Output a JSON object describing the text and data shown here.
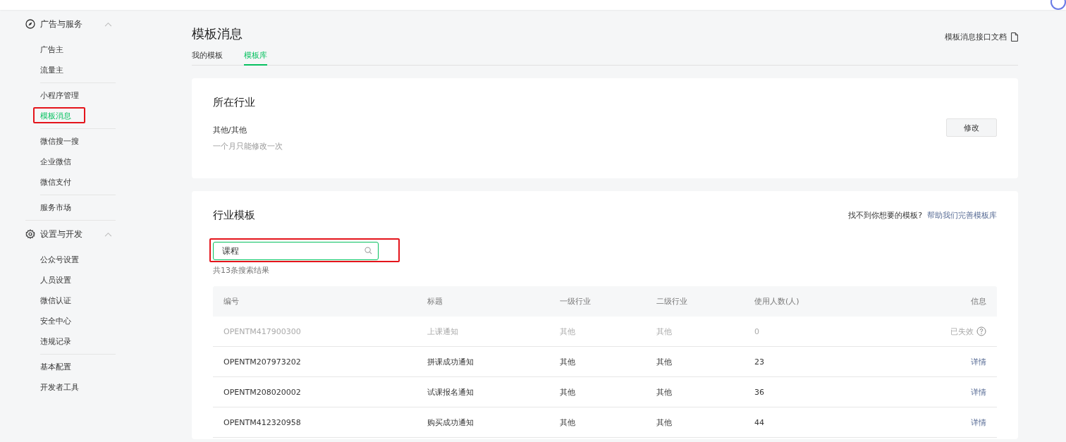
{
  "sidebar": {
    "groups": [
      {
        "title": "广告与服务",
        "kind": "compass",
        "expanded": true,
        "sections": [
          [
            {
              "label": "广告主",
              "selected": false,
              "annotated": false
            },
            {
              "label": "流量主",
              "selected": false,
              "annotated": false
            }
          ],
          [
            {
              "label": "小程序管理",
              "selected": false,
              "annotated": false
            },
            {
              "label": "模板消息",
              "selected": true,
              "annotated": true
            }
          ],
          [
            {
              "label": "微信搜一搜",
              "selected": false,
              "annotated": false
            },
            {
              "label": "企业微信",
              "selected": false,
              "annotated": false
            },
            {
              "label": "微信支付",
              "selected": false,
              "annotated": false
            }
          ],
          [
            {
              "label": "服务市场",
              "selected": false,
              "annotated": false
            }
          ]
        ]
      },
      {
        "title": "设置与开发",
        "kind": "gear",
        "expanded": true,
        "sections": [
          [
            {
              "label": "公众号设置",
              "selected": false,
              "annotated": false
            },
            {
              "label": "人员设置",
              "selected": false,
              "annotated": false
            },
            {
              "label": "微信认证",
              "selected": false,
              "annotated": false
            },
            {
              "label": "安全中心",
              "selected": false,
              "annotated": false
            },
            {
              "label": "违规记录",
              "selected": false,
              "annotated": false
            }
          ],
          [
            {
              "label": "基本配置",
              "selected": false,
              "annotated": false
            },
            {
              "label": "开发者工具",
              "selected": false,
              "annotated": false
            }
          ]
        ]
      }
    ]
  },
  "page": {
    "title": "模板消息",
    "doc_link": "模板消息接口文档",
    "tabs": [
      {
        "label": "我的模板",
        "selected": false
      },
      {
        "label": "模板库",
        "selected": true
      }
    ]
  },
  "industry_card": {
    "title": "所在行业",
    "value": "其他/其他",
    "note": "一个月只能修改一次",
    "button": "修改"
  },
  "template_card": {
    "title": "行业模板",
    "hint": "找不到你想要的模板?",
    "hint_link": "帮助我们完善模板库",
    "search": {
      "value": "课程",
      "annotated": true
    },
    "result_count": "共13条搜索结果",
    "columns": [
      "编号",
      "标题",
      "一级行业",
      "二级行业",
      "使用人数(人)",
      "信息"
    ],
    "rows": [
      {
        "id": "OPENTM417900300",
        "title": "上课通知",
        "industry_1": "其他",
        "industry_2": "其他",
        "users": "0",
        "info": "已失效",
        "disabled": true
      },
      {
        "id": "OPENTM207973202",
        "title": "拼课成功通知",
        "industry_1": "其他",
        "industry_2": "其他",
        "users": "23",
        "info": "详情",
        "disabled": false
      },
      {
        "id": "OPENTM208020002",
        "title": "试课报名通知",
        "industry_1": "其他",
        "industry_2": "其他",
        "users": "36",
        "info": "详情",
        "disabled": false
      },
      {
        "id": "OPENTM412320958",
        "title": "购买成功通知",
        "industry_1": "其他",
        "industry_2": "其他",
        "users": "44",
        "info": "详情",
        "disabled": false
      }
    ]
  }
}
